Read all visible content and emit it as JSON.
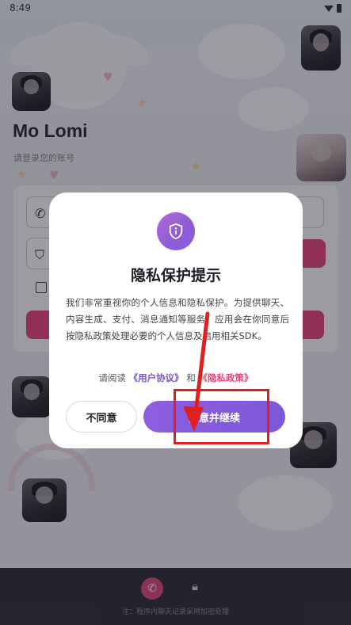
{
  "statusbar": {
    "time": "8:49"
  },
  "app": {
    "title": "Mo Lomi",
    "subtitle": "请登录您的账号"
  },
  "bottom": {
    "note": "注：程序内聊天记录采用加密处理"
  },
  "dialog": {
    "title": "隐私保护提示",
    "body": "我们非常重视你的个人信息和隐私保护。为提供聊天、内容生成、支付、消息通知等服务，应用会在你同意后按隐私政策处理必要的个人信息及启用相关SDK。",
    "links_prefix": "请阅读",
    "user_agreement": "《用户协议》",
    "links_and": "和",
    "privacy_policy": "《隐私政策》",
    "decline_label": "不同意",
    "agree_label": "同意并继续"
  },
  "colors": {
    "accent_purple": "#7d57d8",
    "accent_pink": "#e9467a",
    "highlight_red": "#e0201c"
  },
  "icons": {
    "dialog": "shield-info-icon",
    "phone_field": "phone-icon",
    "code_field": "shield-check-icon",
    "bottom_phone": "phone-icon",
    "bottom_lock": "lock-icon"
  }
}
